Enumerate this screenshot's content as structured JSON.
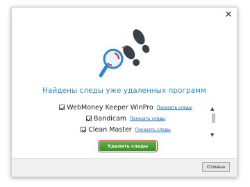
{
  "dialog": {
    "close_glyph": "✕",
    "headline": "Найдены следы уже удаленных программ",
    "programs": [
      {
        "name": "WebMoney Keeper WinPro",
        "link": "Показать следы",
        "checked": true
      },
      {
        "name": "Bandicam",
        "link": "Показать следы",
        "checked": true
      },
      {
        "name": "Clean Master",
        "link": "Показать следы",
        "checked": true
      }
    ],
    "scroll_up_glyph": "▲",
    "scroll_down_glyph": "▼",
    "delete_label": "Удалить следы",
    "cancel_label": "Отмена"
  },
  "icons": {
    "hero": "footprints-magnifier-icon",
    "checkbox": "checkbox-checked-icon"
  },
  "colors": {
    "headline": "#2a8bd4",
    "link": "#1f5dcc",
    "delete_button": "#4aa134",
    "delete_outline": "#d9383c",
    "footprint": "#3a4048",
    "magnifier": "#2a86d4",
    "red_marks": "#e0303a"
  }
}
